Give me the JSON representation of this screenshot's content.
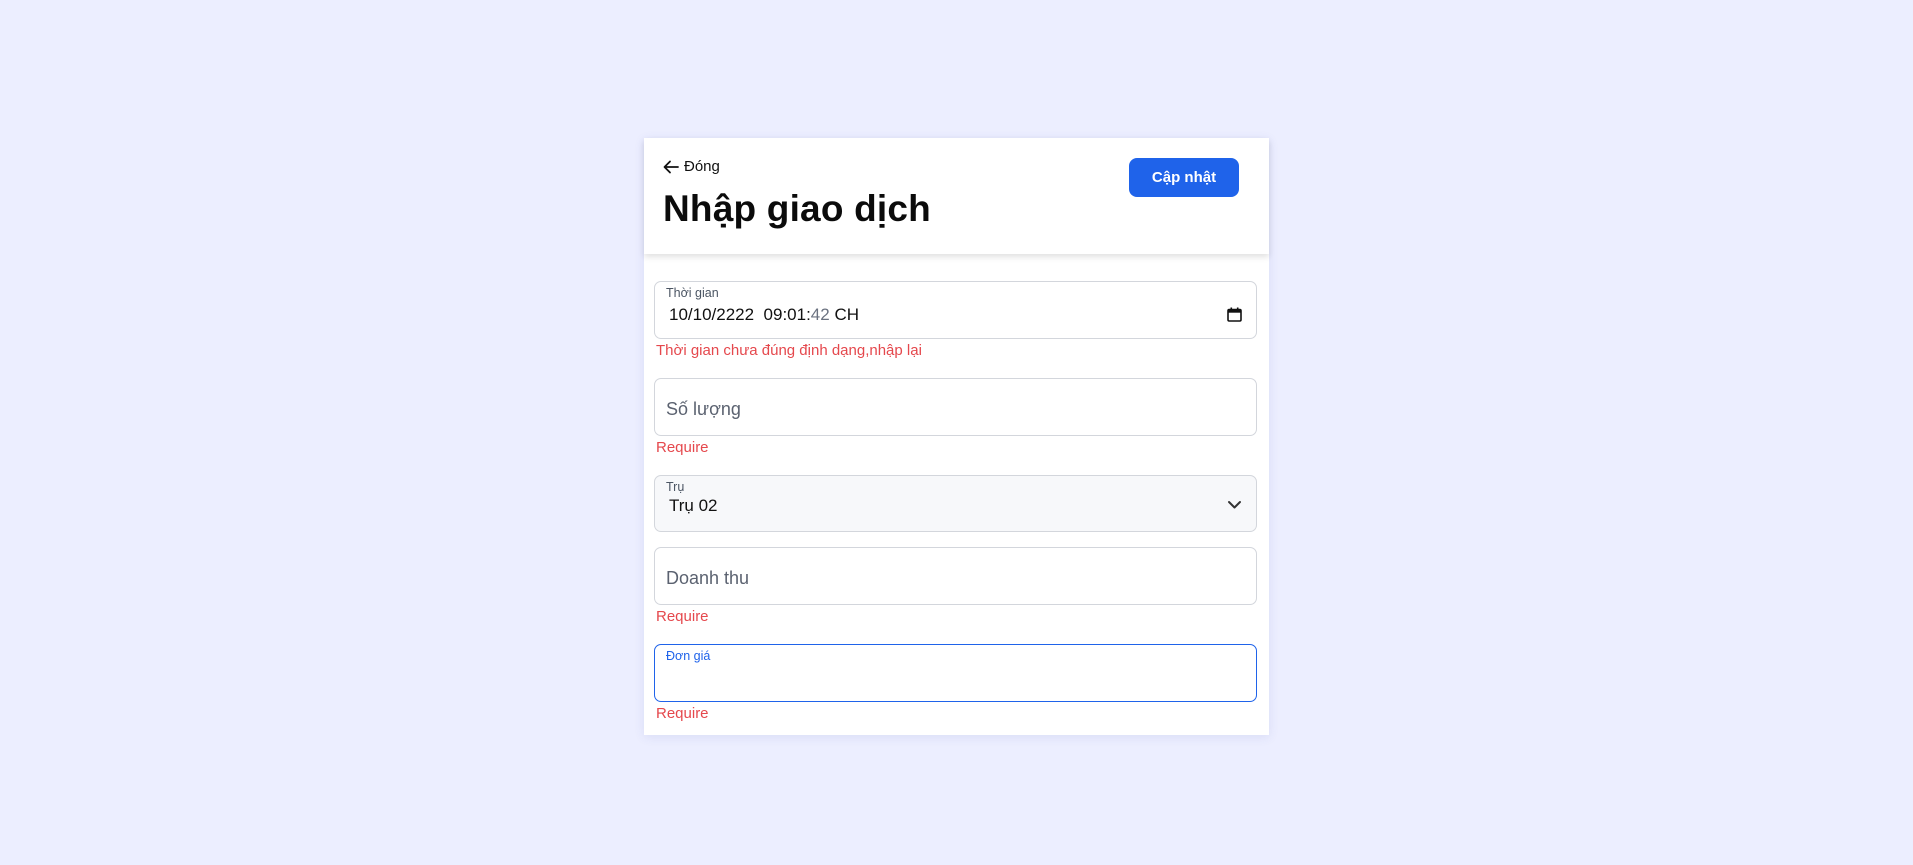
{
  "header": {
    "back_label": "Đóng",
    "title": "Nhập giao dịch",
    "update_label": "Cập nhật"
  },
  "form": {
    "time": {
      "label": "Thời gian",
      "value_main": "10/10/2222  09:01:",
      "value_seconds": "42",
      "value_ampm": "CH",
      "error": "Thời gian chưa đúng định dạng,nhập lại"
    },
    "quantity": {
      "placeholder": "Số lượng",
      "error": "Require"
    },
    "pump": {
      "label": "Trụ",
      "value": "Trụ 02"
    },
    "revenue": {
      "placeholder": "Doanh thu",
      "error": "Require"
    },
    "unit_price": {
      "label": "Đơn giá",
      "value": "",
      "error": "Require"
    }
  },
  "icons": {
    "back": "arrow-left-icon",
    "calendar": "calendar-icon",
    "dropdown": "chevron-down-icon"
  },
  "colors": {
    "background": "#eceeff",
    "accent": "#1f63ea",
    "error": "#e5484d"
  }
}
